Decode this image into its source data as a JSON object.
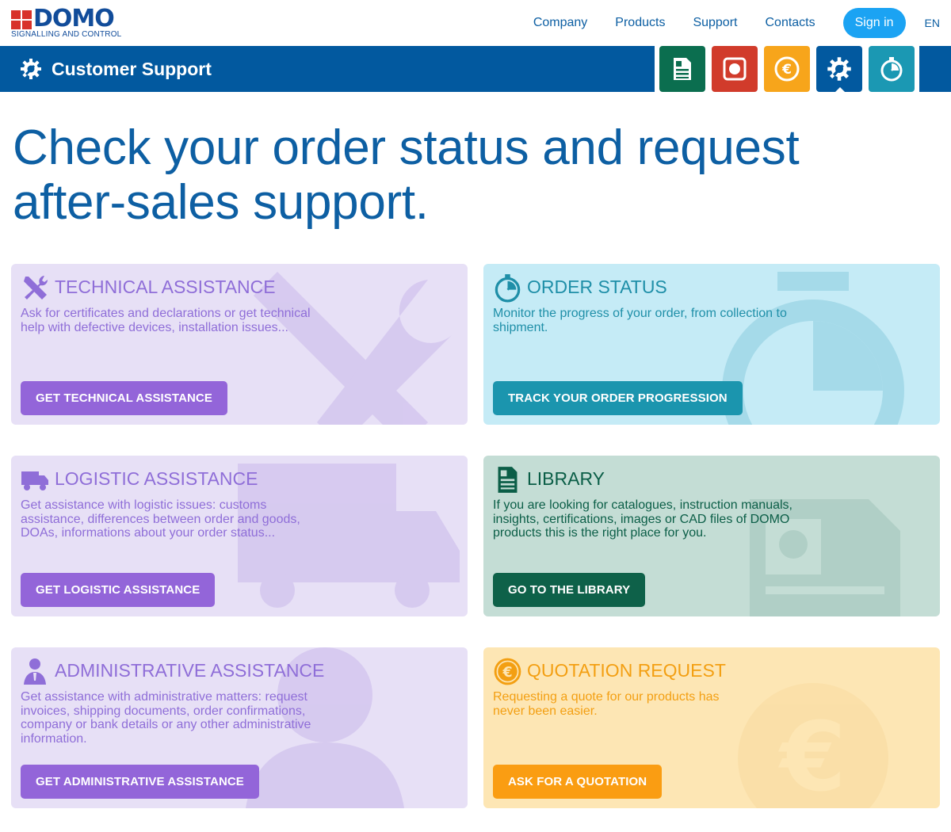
{
  "brand": {
    "name": "DOMO",
    "tagline": "SIGNALLING AND CONTROL",
    "red": "#d8322a",
    "blue": "#114c9a"
  },
  "nav": {
    "items": [
      "Company",
      "Products",
      "Support",
      "Contacts"
    ],
    "signin": "Sign in",
    "lang": "EN"
  },
  "section": {
    "title": "Customer Support",
    "icon": "gear-wrench-icon",
    "bar_color": "#02599f"
  },
  "quick_tiles": [
    {
      "icon": "document-icon",
      "color": "#0b6e4f"
    },
    {
      "icon": "record-icon",
      "color": "#d13b2b"
    },
    {
      "icon": "euro-icon",
      "color": "#f7a51b"
    },
    {
      "icon": "gear-wrench-icon",
      "color": "#02599f",
      "active": true
    },
    {
      "icon": "stopwatch-icon",
      "color": "#1b98b3"
    }
  ],
  "hero": {
    "line1": "Check your order status and request",
    "line2": "after-sales support."
  },
  "cards": [
    {
      "title": "TECHNICAL ASSISTANCE",
      "description": "Ask for certificates and declarations or get technical help with defective devices, installation issues...",
      "button": "GET TECHNICAL ASSISTANCE",
      "icon": "tools-icon",
      "theme": "purple"
    },
    {
      "title": "ORDER STATUS",
      "description": "Monitor the progress of your order, from collection to shipment.",
      "button": "TRACK YOUR ORDER PROGRESSION",
      "icon": "stopwatch-icon",
      "theme": "cyan"
    },
    {
      "title": "LOGISTIC ASSISTANCE",
      "description": "Get assistance with logistic issues: customs assistance, differences between order and goods, DOAs, informations about your order status...",
      "button": "GET LOGISTIC ASSISTANCE",
      "icon": "truck-icon",
      "theme": "purple"
    },
    {
      "title": "LIBRARY",
      "description": "If you are looking for catalogues, instruction manuals, insights, certifications, images or CAD files of DOMO products this is the right place for you.",
      "button": "GO TO THE LIBRARY",
      "icon": "document-icon",
      "theme": "green"
    },
    {
      "title": "ADMINISTRATIVE ASSISTANCE",
      "description": "Get assistance with administrative matters: request invoices, shipping documents, order confirmations, company or bank details or any other administrative information.",
      "button": "GET ADMINISTRATIVE ASSISTANCE",
      "icon": "person-icon",
      "theme": "purple"
    },
    {
      "title": "QUOTATION REQUEST",
      "description": "Requesting a quote for our products has never been easier.",
      "button": "ASK FOR A QUOTATION",
      "icon": "euro-icon",
      "theme": "yellow"
    }
  ]
}
